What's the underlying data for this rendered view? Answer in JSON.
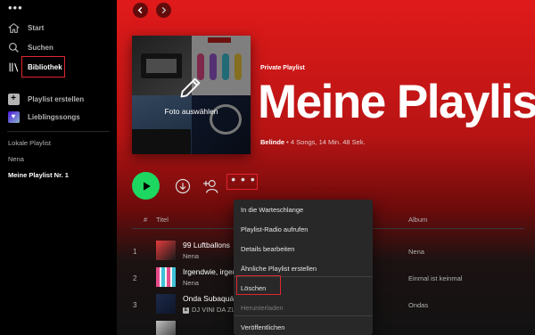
{
  "sidebar": {
    "menu_dots": "•••",
    "nav": [
      {
        "label": "Start",
        "icon": "home-icon"
      },
      {
        "label": "Suchen",
        "icon": "search-icon"
      },
      {
        "label": "Bibliothek",
        "icon": "library-icon"
      }
    ],
    "actions": [
      {
        "label": "Playlist erstellen",
        "icon": "plus-icon"
      },
      {
        "label": "Lieblingssongs",
        "icon": "heart-icon"
      }
    ],
    "playlists": [
      "Lokale Playlist",
      "Nena",
      "Meine Playlist Nr. 1"
    ]
  },
  "header": {
    "cover_label": "Foto auswählen",
    "type": "Private Playlist",
    "title": "Meine Playlist",
    "owner": "Belinde",
    "meta": " • 4 Songs, 14 Min. 48 Sek."
  },
  "actions": {
    "more_dots": "• • •"
  },
  "table": {
    "headers": {
      "num": "#",
      "title": "Titel",
      "album": "Album"
    },
    "rows": [
      {
        "num": "1",
        "title": "99 Luftballons",
        "artist": "Nena",
        "album": "Nena",
        "badge": ""
      },
      {
        "num": "2",
        "title": "Irgendwie, irgendwo, irgendwann",
        "artist": "Nena",
        "album": "Einmal ist keinmal",
        "badge": ""
      },
      {
        "num": "3",
        "title": "Onda Subaquática",
        "artist": "DJ VINI DA ZL, Yuri ...",
        "album": "Ondas",
        "badge": "E"
      }
    ]
  },
  "context_menu": {
    "items": [
      "In die Warteschlange",
      "Playlist-Radio aufrufen",
      "Details bearbeiten",
      "Ähnliche Playlist erstellen",
      "Löschen",
      "Herunterladen",
      "Veröffentlichen"
    ]
  },
  "colors": {
    "accent_green": "#1ed760",
    "header_red": "#e01a1a",
    "highlight_box": "#e0262e"
  }
}
